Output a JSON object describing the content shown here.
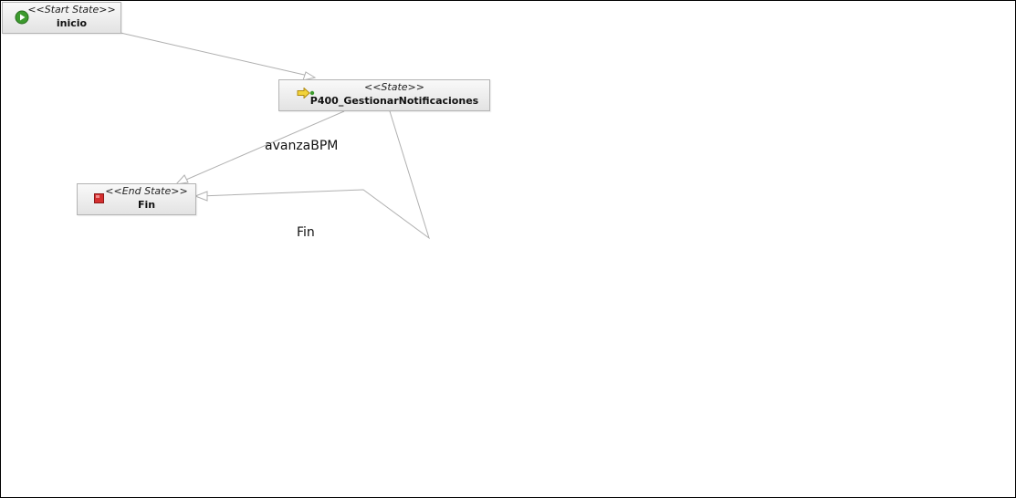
{
  "diagram": {
    "nodes": {
      "start": {
        "stereotype": "<<Start State>>",
        "name": "inicio",
        "icon": "play-icon"
      },
      "state": {
        "stereotype": "<<State>>",
        "name": "P400_GestionarNotificaciones",
        "icon": "state-arrow-icon"
      },
      "end": {
        "stereotype": "<<End State>>",
        "name": "Fin",
        "icon": "stop-icon"
      }
    },
    "transitions": [
      {
        "from": "inicio",
        "to": "P400_GestionarNotificaciones",
        "label": ""
      },
      {
        "from": "P400_GestionarNotificaciones",
        "to": "Fin",
        "label": "avanzaBPM"
      },
      {
        "from": "P400_GestionarNotificaciones",
        "to": "Fin",
        "label": "Fin"
      }
    ],
    "colors": {
      "node_border": "#b4b4b4",
      "edge": "#b0b0b0",
      "start_icon": "#3c9a2e",
      "end_icon": "#d42f2f",
      "state_icon": "#e8c020"
    }
  }
}
